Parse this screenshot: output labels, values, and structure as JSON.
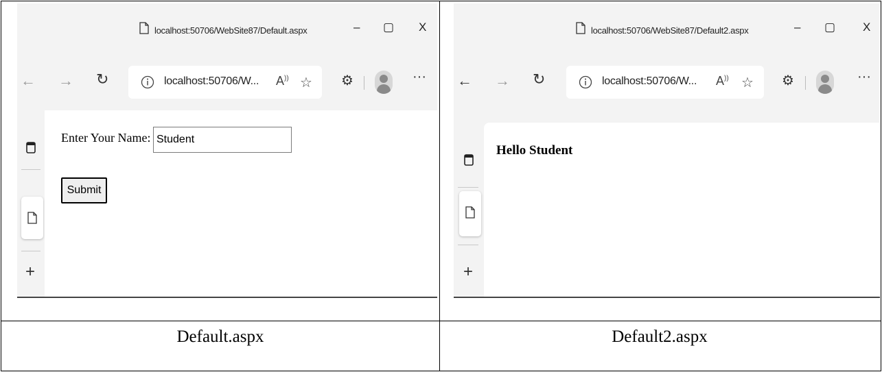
{
  "left_browser": {
    "title": "localhost:50706/WebSite87/Default.aspx",
    "address": "localhost:50706/W...",
    "window_buttons": {
      "minimize": "–",
      "maximize": "▢",
      "close": "X"
    },
    "form": {
      "name_label": "Enter Your Name:",
      "name_value": "Student",
      "submit_label": "Submit"
    }
  },
  "right_browser": {
    "title": "localhost:50706/WebSite87/Default2.aspx",
    "address": "localhost:50706/W...",
    "window_buttons": {
      "minimize": "–",
      "maximize": "▢",
      "close": "X"
    },
    "greeting": "Hello Student"
  },
  "captions": {
    "left": "Default.aspx",
    "right": "Default2.aspx"
  },
  "icons": {
    "back": "back-arrow-icon",
    "forward": "forward-arrow-icon",
    "refresh": "refresh-icon",
    "info": "info-icon",
    "read_aloud": "read-aloud-icon",
    "favorite": "add-favorite-icon",
    "extensions": "extensions-icon",
    "profile": "profile-avatar-icon",
    "more": "more-icon"
  }
}
